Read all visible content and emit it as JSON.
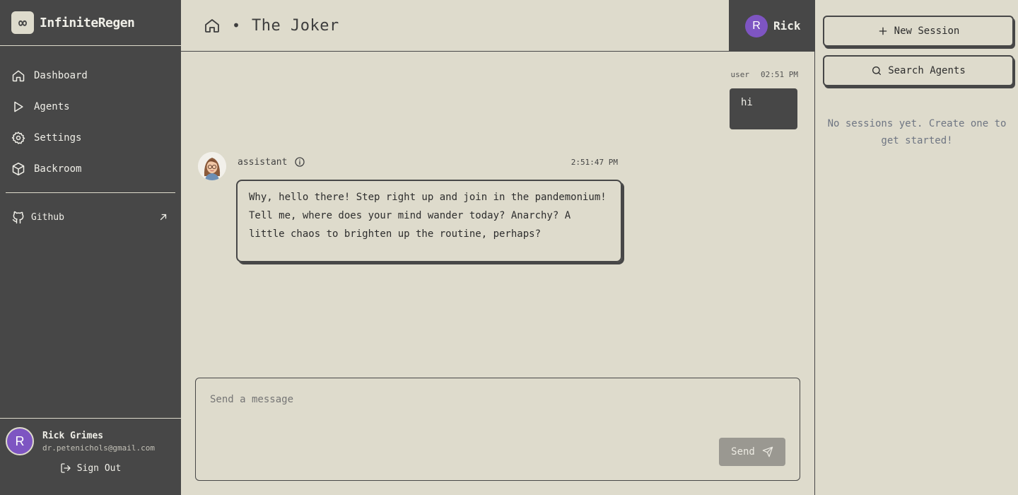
{
  "sidebar": {
    "brand": "InfiniteRegen",
    "nav": [
      {
        "label": "Dashboard",
        "icon": "home-icon"
      },
      {
        "label": "Agents",
        "icon": "play-icon"
      },
      {
        "label": "Settings",
        "icon": "gear-icon"
      },
      {
        "label": "Backroom",
        "icon": "box-icon"
      }
    ],
    "github_label": "Github",
    "user": {
      "initial": "R",
      "name": "Rick Grimes",
      "email": "dr.petenichols@gmail.com"
    },
    "signout_label": "Sign Out"
  },
  "header": {
    "title": "The Joker",
    "separator": "•",
    "user_initial": "R",
    "user_name": "Rick"
  },
  "chat": {
    "messages": [
      {
        "role": "user",
        "time": "02:51 PM",
        "text": "hi"
      },
      {
        "role": "assistant",
        "time": "2:51:47 PM",
        "text": "Why, hello there! Step right up and join in the pandemonium! Tell me, where does your mind wander today? Anarchy? A little chaos to brighten up the routine, perhaps?"
      }
    ],
    "composer_placeholder": "Send a message",
    "send_label": "Send"
  },
  "panel": {
    "new_session_label": "New Session",
    "search_agents_label": "Search Agents",
    "empty_text": "No sessions yet. Create one to get started!"
  },
  "colors": {
    "background": "#dedbcc",
    "sidebar": "#474747",
    "avatar": "#7e55c2",
    "send_disabled": "#9a9891"
  }
}
